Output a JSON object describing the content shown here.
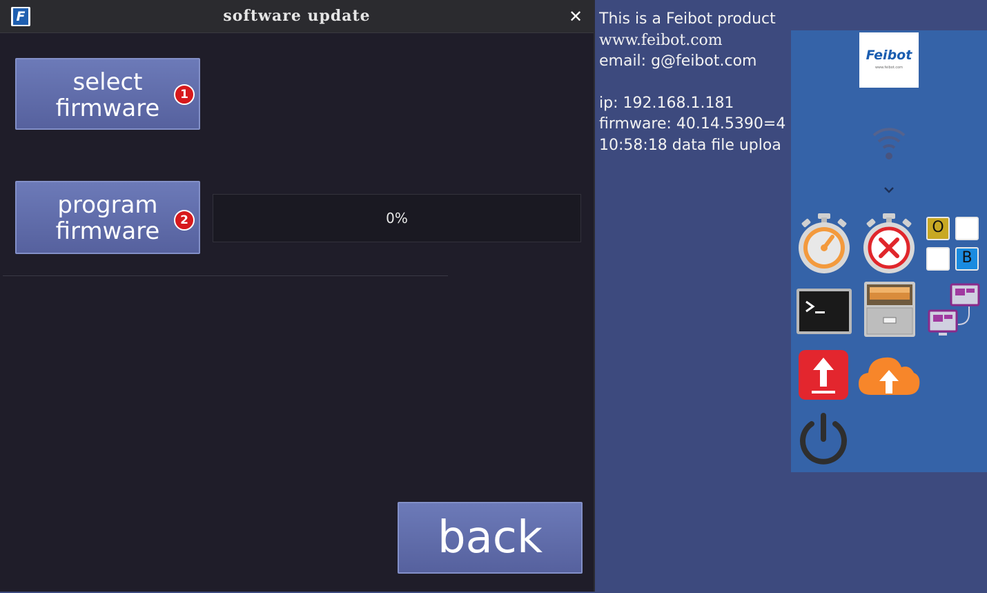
{
  "dialog": {
    "title": "software update",
    "logo_letter": "F",
    "close_glyph": "✕",
    "select_button": {
      "line1": "select",
      "line2": "firmware",
      "badge": "1"
    },
    "program_button": {
      "line1": "program",
      "line2": "firmware",
      "badge": "2"
    },
    "progress": {
      "percent": 0,
      "text": "0%"
    },
    "back_label": "back"
  },
  "info": {
    "line1": "This is a Feibot product",
    "line2": "www.feibot.com",
    "line3": "email: g@feibot.com",
    "ip": "ip: 192.168.1.181",
    "firmware": "firmware: 40.14.5390=4",
    "status": "10:58:18 data file uploa"
  },
  "panel": {
    "logo_name": "Feibot",
    "logo_site": "www.feibot.com",
    "keyboard_keys": [
      "O",
      "B"
    ],
    "icons": [
      "feibot-logo",
      "wifi-icon",
      "chevron-down-icon",
      "stopwatch-icon",
      "stopwatch-cancel-icon",
      "keyboard-icon",
      "terminal-icon",
      "file-cabinet-icon",
      "network-icon",
      "upload-icon",
      "cloud-upload-icon",
      "power-icon"
    ]
  },
  "colors": {
    "dialog_bg": "#1f1d29",
    "button": "#6270b0",
    "desktop": "#3d4a7e",
    "panel": "#3563a8",
    "badge": "#d7191c"
  }
}
